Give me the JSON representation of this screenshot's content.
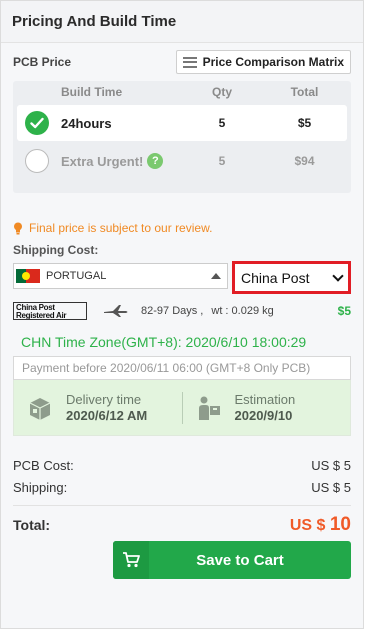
{
  "header": {
    "title": "Pricing And Build Time"
  },
  "pcb_price": {
    "label": "PCB Price",
    "matrix_button": "Price Comparison Matrix",
    "columns": [
      "Build Time",
      "Qty",
      "Total"
    ],
    "rows": [
      {
        "build_time": "24hours",
        "qty": "5",
        "total": "$5",
        "selected": true
      },
      {
        "build_time": "Extra Urgent!",
        "qty": "5",
        "total": "$94",
        "selected": false,
        "help_icon": "?"
      }
    ]
  },
  "notice": {
    "text": "Final price is subject to our review.",
    "color": "#f08a24"
  },
  "shipping": {
    "label": "Shipping Cost:",
    "country": "PORTUGAL",
    "carrier_selected": "China Post",
    "carrier_logo_line1": "China Post",
    "carrier_logo_line2": "Registered Air",
    "days": "82-97 Days ,",
    "weight": "wt : 0.029 kg",
    "price": "$5"
  },
  "time_zone": "CHN Time Zone(GMT+8): 2020/6/10 18:00:29",
  "payment_before": "Payment before 2020/06/11 06:00 (GMT+8 Only PCB)",
  "delivery": {
    "label": "Delivery time",
    "value": "2020/6/12 AM",
    "estimation_label": "Estimation",
    "estimation_value": "2020/9/10"
  },
  "costs": {
    "pcb_label": "PCB Cost:",
    "pcb_value": "US $ 5",
    "shipping_label": "Shipping:",
    "shipping_value": "US $ 5",
    "total_label": "Total:",
    "total_currency": "US $",
    "total_value": "10"
  },
  "cart_button": {
    "label": "Save to Cart",
    "icon": "cart-icon",
    "color": "#22a84a"
  },
  "colors": {
    "accent_green": "#2eb24a",
    "highlight_red": "#e11d25",
    "total_orange": "#f05a28"
  }
}
